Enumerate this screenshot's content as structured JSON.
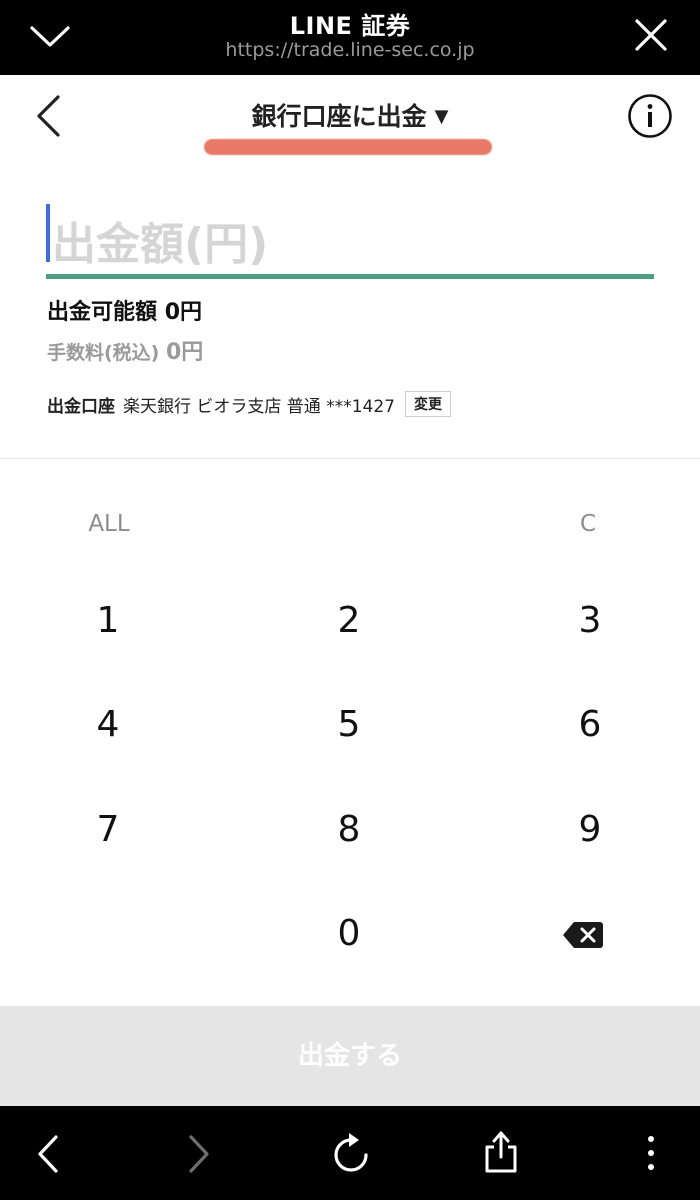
{
  "browser": {
    "title": "LINE 証券",
    "url": "https://trade.line-sec.co.jp"
  },
  "header": {
    "title": "銀行口座に出金",
    "caret": "▼"
  },
  "form": {
    "amount_placeholder": "出金額(円)",
    "available_label": "出金可能額",
    "available_value": "0円",
    "fee_label": "手数料(税込)",
    "fee_value": "0円",
    "account_label": "出金口座",
    "account_value": "楽天銀行 ビオラ支店 普通 ***1427",
    "change_label": "変更"
  },
  "keypad": {
    "all": "ALL",
    "clear": "C",
    "k1": "1",
    "k2": "2",
    "k3": "3",
    "k4": "4",
    "k5": "5",
    "k6": "6",
    "k7": "7",
    "k8": "8",
    "k9": "9",
    "k0": "0",
    "backspace_icon": "backspace-icon"
  },
  "submit": {
    "label": "出金する"
  },
  "colors": {
    "field_underline": "#4f9d83",
    "cursor": "#3d6fd6",
    "highlight": "#e8735f",
    "submit_bg": "#e5e5e6"
  }
}
